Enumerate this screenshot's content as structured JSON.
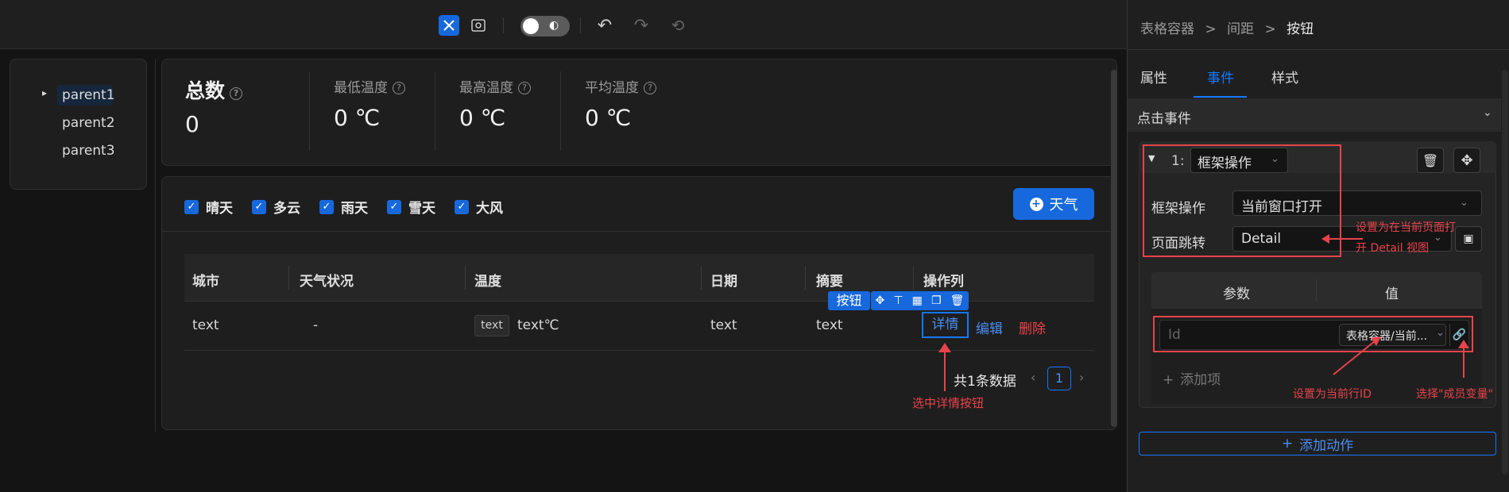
{
  "toolbar": {
    "icons": [
      "design-icon",
      "preview-icon",
      "theme-toggle",
      "undo-icon",
      "redo-icon",
      "history-icon"
    ]
  },
  "tree": {
    "items": [
      "parent1",
      "parent2",
      "parent3"
    ]
  },
  "stats": [
    {
      "label": "总数",
      "value": "0"
    },
    {
      "label": "最低温度",
      "value": "0 ℃"
    },
    {
      "label": "最高温度",
      "value": "0 ℃"
    },
    {
      "label": "平均温度",
      "value": "0 ℃"
    }
  ],
  "filters": [
    "晴天",
    "多云",
    "雨天",
    "雪天",
    "大风"
  ],
  "weather_button": "天气",
  "table": {
    "headers": [
      "城市",
      "天气状况",
      "温度",
      "日期",
      "摘要",
      "操作列"
    ],
    "row": {
      "city": "text",
      "status": "-",
      "temp_tag": "text",
      "temp": "text℃",
      "date": "text",
      "summary": "text"
    },
    "actions": [
      "详情",
      "编辑",
      "删除"
    ],
    "selection_label": "按钮"
  },
  "pagination": {
    "total": "共1条数据",
    "page": "1"
  },
  "annotations": {
    "select_detail": "选中详情按钮",
    "open_detail_line1": "设置为在当前页面打",
    "open_detail_line2": "开 Detail 视图",
    "set_row_id": "设置为当前行ID",
    "choose_member": "选择\"成员变量\""
  },
  "right_panel": {
    "breadcrumb": [
      "表格容器",
      "间距",
      "按钮"
    ],
    "tabs": [
      "属性",
      "事件",
      "样式"
    ],
    "active_tab": "事件",
    "section_title": "点击事件",
    "action_index": "1:",
    "action_type": "框架操作",
    "fields": [
      {
        "label": "框架操作",
        "value": "当前窗口打开"
      },
      {
        "label": "页面跳转",
        "value": "Detail"
      }
    ],
    "param_headers": [
      "参数",
      "值"
    ],
    "param": {
      "name": "Id",
      "value": "表格容器/当前..."
    },
    "add_item": "添加项",
    "add_action": "添加动作"
  },
  "colors": {
    "accent": "#1668dc",
    "annotation": "#e8434b"
  }
}
